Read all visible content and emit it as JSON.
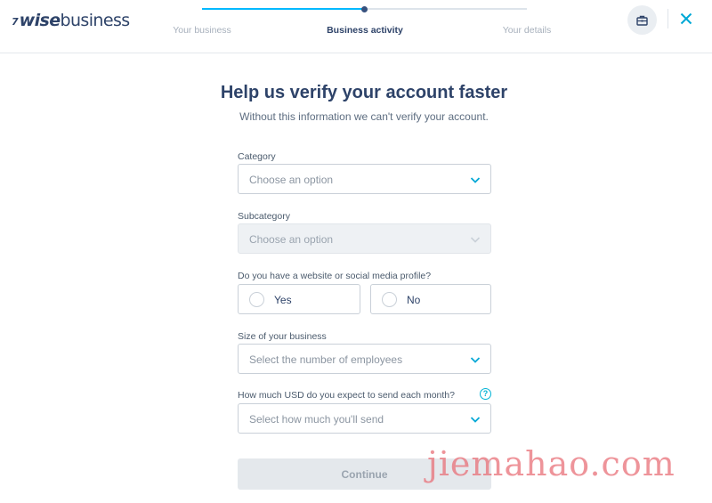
{
  "header": {
    "logo_flag": "7",
    "logo_bold": "wise",
    "logo_rest": "business",
    "steps": [
      "Your business",
      "Business activity",
      "Your details"
    ],
    "active_step": 2,
    "business_icon": "briefcase-icon",
    "close_icon": "close-icon"
  },
  "main": {
    "title": "Help us verify your account faster",
    "subtitle": "Without this information we can't verify your account.",
    "category": {
      "label": "Category",
      "placeholder": "Choose an option"
    },
    "subcategory": {
      "label": "Subcategory",
      "placeholder": "Choose an option",
      "disabled": true
    },
    "website": {
      "label": "Do you have a website or social media profile?",
      "options": [
        "Yes",
        "No"
      ]
    },
    "size": {
      "label": "Size of your business",
      "placeholder": "Select the number of employees"
    },
    "volume": {
      "label": "How much USD do you expect to send each month?",
      "placeholder": "Select how much you'll send",
      "help_icon": "question-icon",
      "help_glyph": "?"
    },
    "continue_label": "Continue"
  },
  "watermark": "jiemahao.com",
  "colors": {
    "accent": "#00b9ff",
    "navy": "#2e4369",
    "chevron": "#00a8d6",
    "disabled_bg": "#eef1f4"
  }
}
